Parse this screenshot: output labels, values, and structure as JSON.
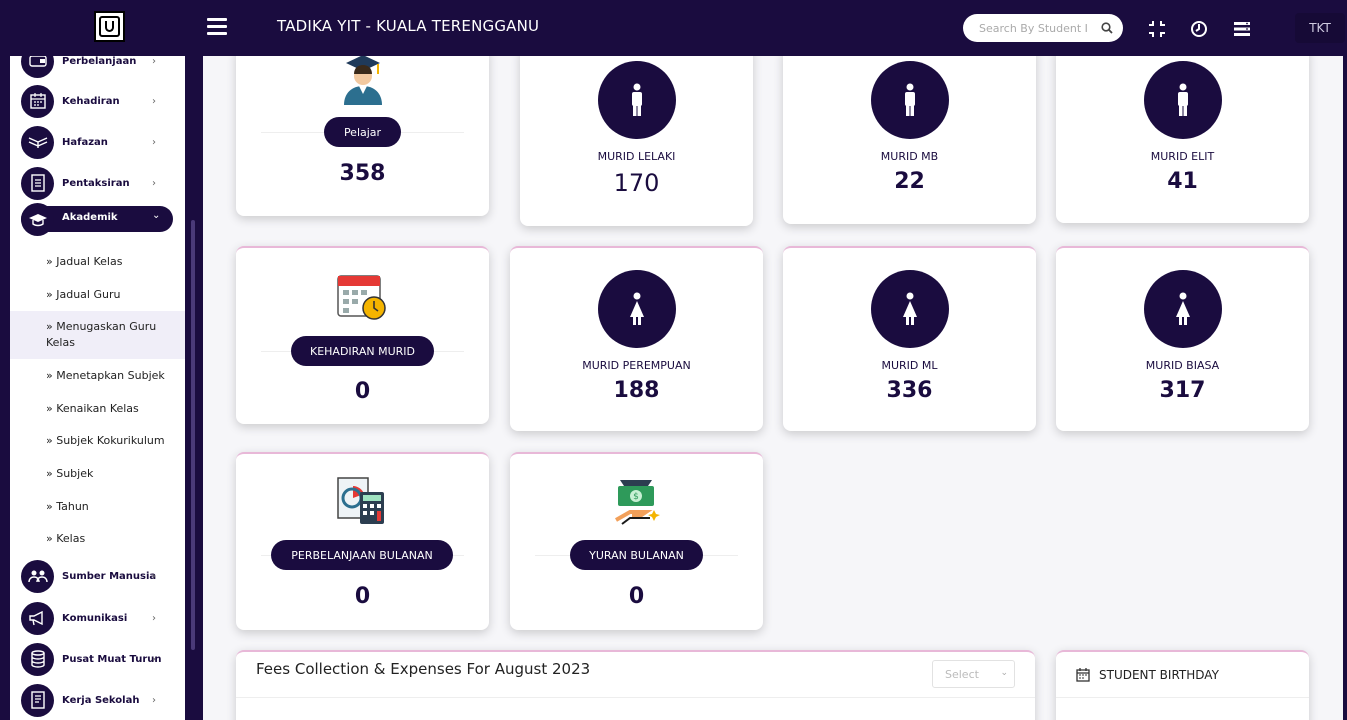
{
  "header": {
    "title": "TADIKA YIT - KUALA TERENGGANU",
    "search_placeholder": "Search By Student I",
    "user_initials": "TKT"
  },
  "sidebar": {
    "items": [
      {
        "label": "Perbelanjaan",
        "icon": "wallet-icon"
      },
      {
        "label": "Kehadiran",
        "icon": "calendar-icon"
      },
      {
        "label": "Hafazan",
        "icon": "quran-icon"
      },
      {
        "label": "Pentaksiran",
        "icon": "checklist-icon"
      },
      {
        "label": "Akademik",
        "icon": "graduation-cap-icon"
      },
      {
        "label": "Sumber Manusia",
        "icon": "people-icon"
      },
      {
        "label": "Komunikasi",
        "icon": "megaphone-icon"
      },
      {
        "label": "Pusat Muat Turun",
        "icon": "database-icon"
      },
      {
        "label": "Kerja Sekolah",
        "icon": "notebook-icon"
      }
    ],
    "akademik_sub": [
      "» Jadual Kelas",
      "» Jadual Guru",
      "» Menugaskan Guru Kelas",
      "» Menetapkan Subjek",
      "» Kenaikan Kelas",
      "» Subjek Kokurikulum",
      "» Subjek",
      "» Tahun",
      "» Kelas"
    ]
  },
  "cards": {
    "pelajar": {
      "label": "Pelajar",
      "count": "358"
    },
    "murid_lelaki": {
      "label": "MURID LELAKI",
      "count": "170"
    },
    "murid_mb": {
      "label": "MURID MB",
      "count": "22"
    },
    "murid_elit": {
      "label": "MURID ELIT",
      "count": "41"
    },
    "kehadiran": {
      "label": "KEHADIRAN MURID",
      "count": "0"
    },
    "murid_perempuan": {
      "label": "MURID PEREMPUAN",
      "count": "188"
    },
    "murid_ml": {
      "label": "MURID ML",
      "count": "336"
    },
    "murid_biasa": {
      "label": "MURID BIASA",
      "count": "317"
    },
    "perbelanjaan": {
      "label": "PERBELANJAAN BULANAN",
      "count": "0"
    },
    "yuran": {
      "label": "YURAN BULANAN",
      "count": "0"
    }
  },
  "fees": {
    "title": "Fees Collection & Expenses For August  2023",
    "select_placeholder": "Select"
  },
  "birthday": {
    "title": "STUDENT BIRTHDAY"
  },
  "colors": {
    "brand": "#1a0c3f",
    "accent_border": "#e8b8d8"
  }
}
